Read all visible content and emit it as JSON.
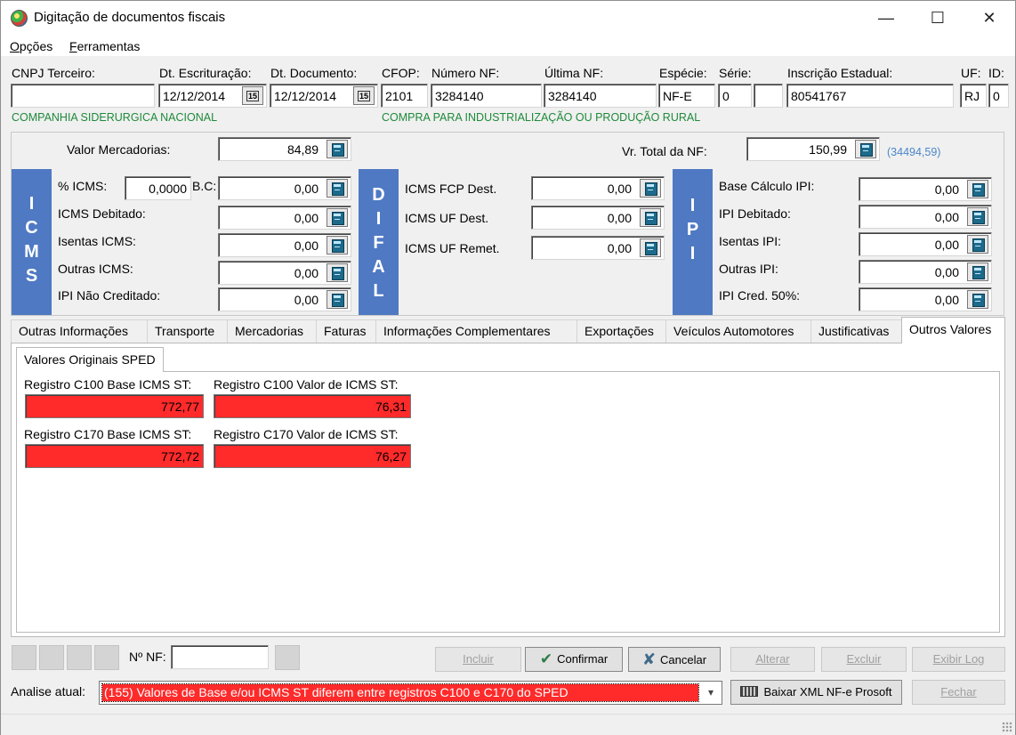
{
  "window": {
    "title": "Digitação de documentos fiscais",
    "minimize": "—",
    "maximize": "☐",
    "close": "✕"
  },
  "menu": [
    "Opções",
    "Ferramentas"
  ],
  "header": {
    "cnpj_label": "CNPJ Terceiro:",
    "cnpj_value": "",
    "company_name": "COMPANHIA SIDERURGICA NACIONAL",
    "dt_escrituracao_label": "Dt. Escrituração:",
    "dt_escrituracao_value": "12/12/2014",
    "dt_documento_label": "Dt. Documento:",
    "dt_documento_value": "12/12/2014",
    "calendar_label": "15",
    "cfop_label": "CFOP:",
    "cfop_value": "2101",
    "cfop_description": "COMPRA PARA INDUSTRIALIZAÇÃO OU PRODUÇÃO RURAL",
    "numero_nf_label": "Número NF:",
    "numero_nf_value": "3284140",
    "ultima_nf_label": "Última NF:",
    "ultima_nf_value": "3284140",
    "especie_label": "Espécie:",
    "especie_value": "NF-E",
    "serie_label": "Série:",
    "serie_value": "0",
    "serie_extra_value": "",
    "ie_label": "Inscrição Estadual:",
    "ie_value": "80541767",
    "uf_label": "UF:",
    "uf_value": "RJ",
    "id_label": "ID:",
    "id_value": "0"
  },
  "valores": {
    "valor_mercadorias_label": "Valor Mercadorias:",
    "valor_mercadorias_value": "84,89",
    "vr_total_nf_label": "Vr. Total da NF:",
    "vr_total_nf_value": "150,99",
    "vr_total_note": "(34494,59)"
  },
  "icms": {
    "bar_letters": [
      "I",
      "C",
      "M",
      "S"
    ],
    "pct_label": "% ICMS:",
    "pct_value": "0,0000",
    "bc_label": "B.C:",
    "bc_value": "0,00",
    "debitado_label": "ICMS Debitado:",
    "debitado_value": "0,00",
    "isentas_label": "Isentas ICMS:",
    "isentas_value": "0,00",
    "outras_label": "Outras ICMS:",
    "outras_value": "0,00",
    "ipi_nao_cred_label": "IPI Não Creditado:",
    "ipi_nao_cred_value": "0,00"
  },
  "difal": {
    "bar_letters": [
      "D",
      "I",
      "F",
      "A",
      "L"
    ],
    "fcp_dest_label": "ICMS FCP Dest.",
    "fcp_dest_value": "0,00",
    "uf_dest_label": "ICMS UF Dest.",
    "uf_dest_value": "0,00",
    "uf_remet_label": "ICMS UF Remet.",
    "uf_remet_value": "0,00"
  },
  "ipi": {
    "bar_letters": [
      "I",
      "P",
      "I"
    ],
    "base_label": "Base Cálculo IPI:",
    "base_value": "0,00",
    "debitado_label": "IPI Debitado:",
    "debitado_value": "0,00",
    "isentas_label": "Isentas IPI:",
    "isentas_value": "0,00",
    "outras_label": "Outras IPI:",
    "outras_value": "0,00",
    "cred50_label": "IPI Cred. 50%:",
    "cred50_value": "0,00"
  },
  "tabs": [
    "Outras Informações",
    "Transporte",
    "Mercadorias",
    "Faturas",
    "Informações Complementares",
    "Exportações",
    "Veículos Automotores",
    "Justificativas",
    "Outros Valores"
  ],
  "sped": {
    "subtab_label": "Valores Originais SPED",
    "c100_base_label": "Registro C100 Base ICMS ST:",
    "c100_base_value": "772,77",
    "c100_valor_label": "Registro C100 Valor de ICMS ST:",
    "c100_valor_value": "76,31",
    "c170_base_label": "Registro C170 Base ICMS ST:",
    "c170_base_value": "772,72",
    "c170_valor_label": "Registro C170 Valor de ICMS ST:",
    "c170_valor_value": "76,27"
  },
  "footer": {
    "nf_label": "Nº NF:",
    "nf_value": "",
    "incluir": "Incluir",
    "confirmar": "Confirmar",
    "cancelar": "Cancelar",
    "alterar": "Alterar",
    "excluir": "Excluir",
    "exibir_log": "Exibir Log",
    "analise_label": "Analise atual:",
    "analise_value": "(155) Valores de Base e/ou ICMS ST diferem entre registros C100 e C170 do SPED",
    "baixar_xml": "Baixar XML NF-e Prosoft",
    "fechar": "Fechar"
  },
  "colors": {
    "section_bar": "#4f79c3",
    "alert_red": "#ff2a2a",
    "green_text": "#1e8a3a",
    "note_blue": "#4a86c9"
  }
}
